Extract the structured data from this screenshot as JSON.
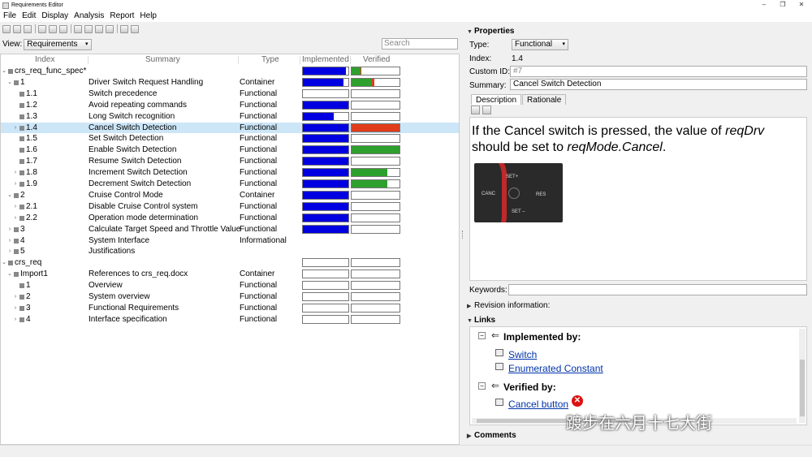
{
  "window": {
    "title": "Requirements Editor",
    "controls": [
      "–",
      "❐",
      "✕"
    ]
  },
  "menu": [
    "File",
    "Edit",
    "Display",
    "Analysis",
    "Report",
    "Help"
  ],
  "view": {
    "label": "View:",
    "value": "Requirements",
    "search_placeholder": "Search"
  },
  "columns": {
    "index": "Index",
    "summary": "Summary",
    "type": "Type",
    "implemented": "Implemented",
    "verified": "Verified"
  },
  "rows": [
    {
      "index": "crs_req_func_spec*",
      "summary": "",
      "type": "",
      "level": 0,
      "toggle": "v",
      "impl": 0.95,
      "verif_green": 0.18,
      "verif_red": 0.03,
      "has_bars": true
    },
    {
      "index": "1",
      "summary": "Driver Switch Request Handling",
      "type": "Container",
      "level": 1,
      "toggle": "v",
      "impl": 0.9,
      "verif_green": 0.42,
      "verif_red": 0.06,
      "has_bars": true
    },
    {
      "index": "1.1",
      "summary": "Switch precedence",
      "type": "Functional",
      "level": 2,
      "toggle": "",
      "impl": 0,
      "verif_green": 0,
      "verif_red": 0,
      "has_bars": true
    },
    {
      "index": "1.2",
      "summary": "Avoid repeating commands",
      "type": "Functional",
      "level": 2,
      "toggle": "",
      "impl": 1,
      "verif_green": 0,
      "verif_red": 0,
      "has_bars": true
    },
    {
      "index": "1.3",
      "summary": "Long Switch recognition",
      "type": "Functional",
      "level": 2,
      "toggle": "",
      "impl": 0.67,
      "verif_green": 0,
      "verif_red": 0,
      "has_bars": true
    },
    {
      "index": "1.4",
      "summary": "Cancel Switch Detection",
      "type": "Functional",
      "level": 2,
      "toggle": "›",
      "impl": 1,
      "verif_green": 0,
      "verif_red": 1,
      "has_bars": true,
      "selected": true
    },
    {
      "index": "1.5",
      "summary": "Set Switch Detection",
      "type": "Functional",
      "level": 2,
      "toggle": "",
      "impl": 1,
      "verif_green": 0,
      "verif_red": 0,
      "has_bars": true
    },
    {
      "index": "1.6",
      "summary": "Enable Switch Detection",
      "type": "Functional",
      "level": 2,
      "toggle": "",
      "impl": 1,
      "verif_green": 1,
      "verif_red": 0,
      "has_bars": true
    },
    {
      "index": "1.7",
      "summary": "Resume Switch Detection",
      "type": "Functional",
      "level": 2,
      "toggle": "",
      "impl": 1,
      "verif_green": 0,
      "verif_red": 0,
      "has_bars": true
    },
    {
      "index": "1.8",
      "summary": "Increment Switch Detection",
      "type": "Functional",
      "level": 2,
      "toggle": "›",
      "impl": 1,
      "verif_green": 0.75,
      "verif_red": 0,
      "has_bars": true
    },
    {
      "index": "1.9",
      "summary": "Decrement Switch Detection",
      "type": "Functional",
      "level": 2,
      "toggle": "›",
      "impl": 1,
      "verif_green": 0.75,
      "verif_red": 0,
      "has_bars": true
    },
    {
      "index": "2",
      "summary": "Cruise Control Mode",
      "type": "Container",
      "level": 1,
      "toggle": "v",
      "impl": 1,
      "verif_green": 0,
      "verif_red": 0,
      "has_bars": true
    },
    {
      "index": "2.1",
      "summary": "Disable Cruise Control system",
      "type": "Functional",
      "level": 2,
      "toggle": "›",
      "impl": 1,
      "verif_green": 0,
      "verif_red": 0,
      "has_bars": true
    },
    {
      "index": "2.2",
      "summary": "Operation mode determination",
      "type": "Functional",
      "level": 2,
      "toggle": "›",
      "impl": 1,
      "verif_green": 0,
      "verif_red": 0,
      "has_bars": true
    },
    {
      "index": "3",
      "summary": "Calculate Target Speed and Throttle Value",
      "type": "Functional",
      "level": 1,
      "toggle": "›",
      "impl": 1,
      "verif_green": 0,
      "verif_red": 0,
      "has_bars": true
    },
    {
      "index": "4",
      "summary": "System Interface",
      "type": "Informational",
      "level": 1,
      "toggle": "›",
      "impl": 0,
      "verif_green": 0,
      "verif_red": 0,
      "has_bars": false
    },
    {
      "index": "5",
      "summary": "Justifications",
      "type": "",
      "level": 1,
      "toggle": "›",
      "impl": 0,
      "verif_green": 0,
      "verif_red": 0,
      "has_bars": false
    },
    {
      "index": "crs_req",
      "summary": "",
      "type": "",
      "level": 0,
      "toggle": "v",
      "impl": 0,
      "verif_green": 0,
      "verif_red": 0,
      "has_bars": true
    },
    {
      "index": "Import1",
      "summary": "References to crs_req.docx",
      "type": "Container",
      "level": 1,
      "toggle": "v",
      "impl": 0,
      "verif_green": 0,
      "verif_red": 0,
      "has_bars": true
    },
    {
      "index": "1",
      "summary": "Overview",
      "type": "Functional",
      "level": 2,
      "toggle": "",
      "impl": 0,
      "verif_green": 0,
      "verif_red": 0,
      "has_bars": true
    },
    {
      "index": "2",
      "summary": "System overview",
      "type": "Functional",
      "level": 2,
      "toggle": "›",
      "impl": 0,
      "verif_green": 0,
      "verif_red": 0,
      "has_bars": true
    },
    {
      "index": "3",
      "summary": "Functional Requirements",
      "type": "Functional",
      "level": 2,
      "toggle": "›",
      "impl": 0,
      "verif_green": 0,
      "verif_red": 0,
      "has_bars": true
    },
    {
      "index": "4",
      "summary": "Interface specification",
      "type": "Functional",
      "level": 2,
      "toggle": "›",
      "impl": 0,
      "verif_green": 0,
      "verif_red": 0,
      "has_bars": true
    }
  ],
  "properties": {
    "header": "Properties",
    "type_label": "Type:",
    "type_value": "Functional",
    "index_label": "Index:",
    "index_value": "1.4",
    "custom_id_label": "Custom ID:",
    "custom_id_value": "#7",
    "summary_label": "Summary:",
    "summary_value": "Cancel Switch Detection",
    "tabs": [
      "Description",
      "Rationale"
    ],
    "description_pre": "If the Cancel switch is pressed, the value of ",
    "description_var1": "reqDrv",
    "description_mid": " should be set to ",
    "description_var2": "reqMode.Cancel",
    "description_post": ".",
    "photo_labels": {
      "set_plus": "SET+",
      "cancel": "CANC",
      "res": "RES",
      "set_minus": "SET –"
    },
    "keywords_label": "Keywords:",
    "keywords_value": "",
    "revision_label": "Revision information:"
  },
  "links": {
    "header": "Links",
    "implemented_label": "Implemented by:",
    "implemented_items": [
      "Switch",
      "Enumerated Constant"
    ],
    "verified_label": "Verified by:",
    "verified_items": [
      "Cancel button"
    ]
  },
  "comments_label": "Comments",
  "watermark": "踱步在六月十七大街",
  "colors": {
    "implemented": "#0000e0",
    "verified_pass": "#2ea02e",
    "verified_fail": "#e03c1c",
    "selection": "#cce6f7"
  }
}
